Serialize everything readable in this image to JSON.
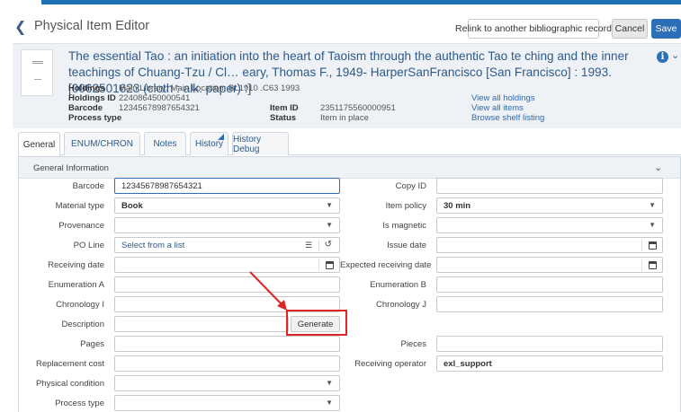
{
  "header": {
    "title": "Physical Item Editor",
    "relink_label": "Relink to another bibliographic record",
    "cancel_label": "Cancel",
    "save_label": "Save"
  },
  "record": {
    "title": "The essential Tao : an initiation into the heart of Taoism through the authentic Tao te ching and the inner teachings of Chuang-Tzu / Cl… eary, Thomas F., 1949- HarperSanFrancisco [San Francisco] : 1993. [0062501623 (cloth : alk. paper) :]",
    "info_glyph": "i",
    "holdings_label": "Holdings",
    "holdings_value": "Main Library: Main Location; BL1910 .C63 1993",
    "holdings_id_label": "Holdings ID",
    "holdings_id_value": "224086450000541",
    "barcode_label": "Barcode",
    "barcode_value": "12345678987654321",
    "process_type_label": "Process type",
    "process_type_value": "-",
    "item_id_label": "Item ID",
    "item_id_value": "2351175560000951",
    "status_label": "Status",
    "status_value": "Item in place",
    "links": [
      "View all holdings",
      "View all items",
      "Browse shelf listing"
    ]
  },
  "tabs": [
    "General",
    "ENUM/CHRON",
    "Notes",
    "History",
    "History Debug"
  ],
  "panel": {
    "title": "General Information"
  },
  "form": {
    "barcode": {
      "label": "Barcode",
      "value": "12345678987654321"
    },
    "material_type": {
      "label": "Material type",
      "value": "Book"
    },
    "provenance": {
      "label": "Provenance",
      "value": ""
    },
    "po_line": {
      "label": "PO Line",
      "placeholder": "Select from a list"
    },
    "receiving_date": {
      "label": "Receiving date",
      "value": ""
    },
    "enumeration_a": {
      "label": "Enumeration A",
      "value": ""
    },
    "chronology_i": {
      "label": "Chronology I",
      "value": ""
    },
    "description": {
      "label": "Description",
      "value": "",
      "generate_label": "Generate"
    },
    "pages": {
      "label": "Pages",
      "value": ""
    },
    "replacement_cost": {
      "label": "Replacement cost",
      "value": ""
    },
    "physical_condition": {
      "label": "Physical condition",
      "value": ""
    },
    "process_type": {
      "label": "Process type",
      "value": ""
    },
    "copy_id": {
      "label": "Copy ID",
      "value": ""
    },
    "item_policy": {
      "label": "Item policy",
      "value": "30 min"
    },
    "is_magnetic": {
      "label": "Is magnetic",
      "value": ""
    },
    "issue_date": {
      "label": "Issue date",
      "value": ""
    },
    "expected_receiving_date": {
      "label": "Expected receiving date",
      "value": ""
    },
    "enumeration_b": {
      "label": "Enumeration B",
      "value": ""
    },
    "chronology_j": {
      "label": "Chronology J",
      "value": ""
    },
    "pieces": {
      "label": "Pieces",
      "value": ""
    },
    "receiving_operator": {
      "label": "Receiving operator",
      "value": "exl_support"
    }
  },
  "icons": {
    "back": "chevron-left-icon",
    "dropdown": "caret-down-icon",
    "calendar": "calendar-icon",
    "list": "list-icon",
    "history": "history-icon"
  },
  "colors": {
    "accent": "#2c6fb6",
    "link": "#2e5a8a",
    "annotation": "#e02424"
  }
}
